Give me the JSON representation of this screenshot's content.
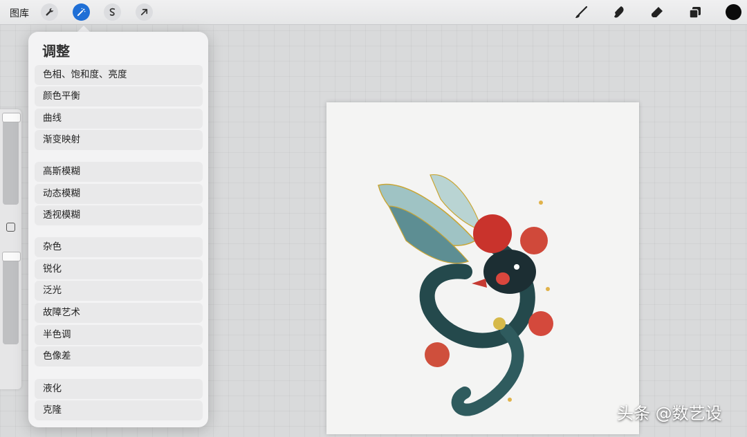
{
  "topbar": {
    "gallery_label": "图库",
    "tools": [
      "wrench-icon",
      "magic-wand-icon",
      "selection-icon",
      "transform-arrow-icon"
    ],
    "active_tool": "magic-wand-icon",
    "right_tools": [
      "brush-icon",
      "smudge-icon",
      "eraser-icon",
      "layers-icon"
    ],
    "current_color": "#0b0b0b",
    "accent_color": "#1f6fd6"
  },
  "adjustments": {
    "title": "调整",
    "items": [
      "色相、饱和度、亮度",
      "颜色平衡",
      "曲线",
      "渐变映射",
      "高斯模糊",
      "动态模糊",
      "透视模糊",
      "杂色",
      "锐化",
      "泛光",
      "故障艺术",
      "半色调",
      "色像差",
      "液化",
      "克隆"
    ]
  },
  "watermark": "头条 @数艺设"
}
